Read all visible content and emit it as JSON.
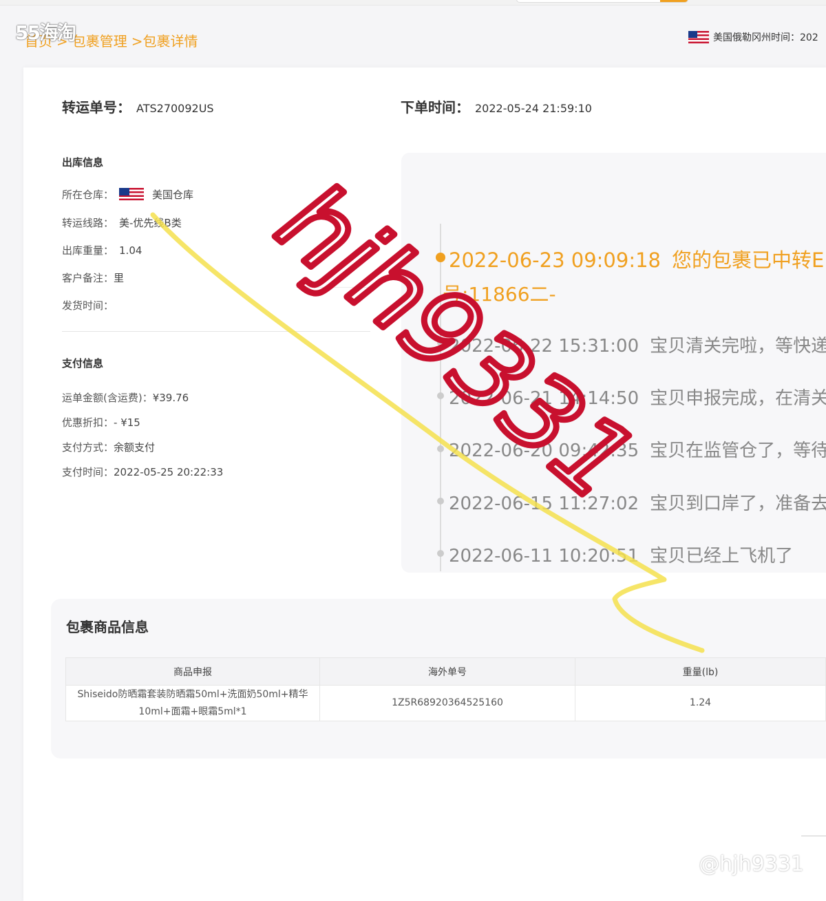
{
  "breadcrumb": {
    "items": [
      "首页",
      ">",
      "包裹管理",
      ">包裹详情"
    ]
  },
  "app_logo_text": "55海淘",
  "timezone": {
    "label": "美国俄勒冈州时间：202"
  },
  "order": {
    "tracking_label": "转运单号：",
    "tracking_value": "ATS270092US",
    "order_time_label": "下单时间：",
    "order_time_value": "2022-05-24 21:59:10"
  },
  "outbound": {
    "title": "出库信息",
    "warehouse_label": "所在仓库：",
    "warehouse_value": "美国仓库",
    "route_label": "转运线路：",
    "route_value": "美-优先线B类",
    "weight_label": "出库重量：",
    "weight_value": "1.04",
    "note_label": "客户备注：",
    "note_value": "里",
    "ship_time_label": "发货时间："
  },
  "payment": {
    "title": "支付信息",
    "amount_label": "运单金额(含运费)：",
    "amount_value": "¥39.76",
    "discount_label": "优惠折扣：",
    "discount_value": "- ¥15",
    "method_label": "支付方式：",
    "method_value": "余额支付",
    "time_label": "支付时间：",
    "time_value": "2022-05-25 20:22:33"
  },
  "timeline": [
    {
      "time": "2022-06-23 09:09:18",
      "msg": "您的包裹已中转EM",
      "sub": "号:11866二-"
    },
    {
      "time": "2022-06-22 15:31:00",
      "msg": "宝贝清关完啦，等快递小"
    },
    {
      "time": "2022-06-21 14:14:50",
      "msg": "宝贝申报完成，在清关啦"
    },
    {
      "time": "2022-06-20 09:42:35",
      "msg": "宝贝在监管仓了，等待"
    },
    {
      "time": "2022-06-15 11:27:02",
      "msg": "宝贝到口岸了，准备去监"
    },
    {
      "time": "2022-06-11 10:20:51",
      "msg": "宝贝已经上飞机了"
    }
  ],
  "goods": {
    "title": "包裹商品信息",
    "headers": [
      "商品申报",
      "海外单号",
      "重量(lb)"
    ],
    "rows": [
      [
        "Shiseido防晒霜套装防晒霜50ml+洗面奶50ml+精华10ml+面霜+眼霜5ml*1",
        "1Z5R68920364525160",
        "1.24"
      ]
    ]
  },
  "watermarks": {
    "handwritten": "hjh9331",
    "corner": "@hjh9331"
  },
  "colors": {
    "accent": "#f0a020",
    "signature": "#c8102e",
    "highlighter": "#f4e04d"
  }
}
